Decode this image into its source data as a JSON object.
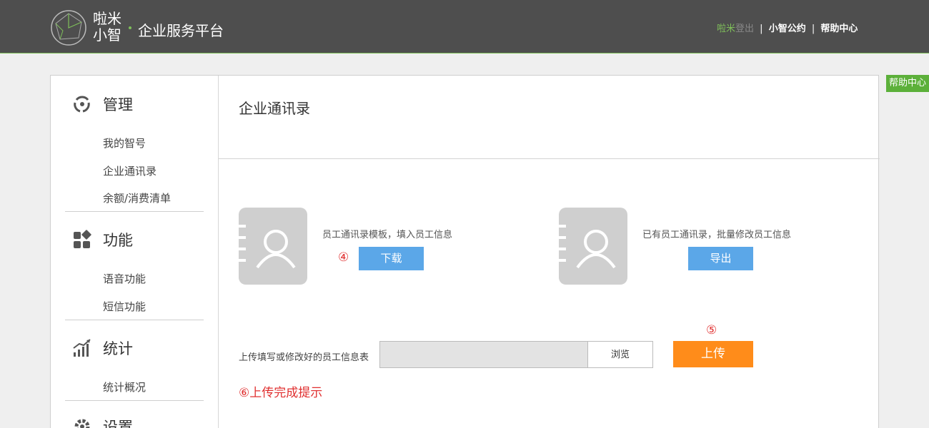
{
  "header": {
    "logo_line1": "啦米",
    "logo_line2": "小智",
    "subtitle": "企业服务平台",
    "links": {
      "brand": "啦米",
      "login": "登出",
      "convention": "小智公约",
      "help": "帮助中心",
      "separator": "|"
    }
  },
  "sidebar": {
    "sections": [
      {
        "title": "管理",
        "icon": "manage-icon",
        "items": [
          "我的智号",
          "企业通讯录",
          "余额/消费清单"
        ]
      },
      {
        "title": "功能",
        "icon": "function-icon",
        "items": [
          "语音功能",
          "短信功能"
        ]
      },
      {
        "title": "统计",
        "icon": "stats-icon",
        "items": [
          "统计概况"
        ]
      },
      {
        "title": "设置",
        "icon": "settings-icon",
        "items": []
      }
    ]
  },
  "main": {
    "title": "企业通讯录",
    "template_card": {
      "desc": "员工通讯录模板，填入员工信息",
      "button": "下载",
      "marker": "④"
    },
    "export_card": {
      "desc": "已有员工通讯录，批量修改员工信息",
      "button": "导出"
    },
    "upload": {
      "label": "上传填写或修改好的员工信息表",
      "browse": "浏览",
      "button": "上传",
      "marker": "⑤",
      "tip": "⑥上传完成提示"
    }
  },
  "help_float": "帮助中心",
  "colors": {
    "header_bg": "#4e4e4e",
    "accent_green": "#5cb03a",
    "button_blue": "#5ba7e8",
    "button_orange": "#ff8c1a",
    "marker_red": "#e03030"
  }
}
